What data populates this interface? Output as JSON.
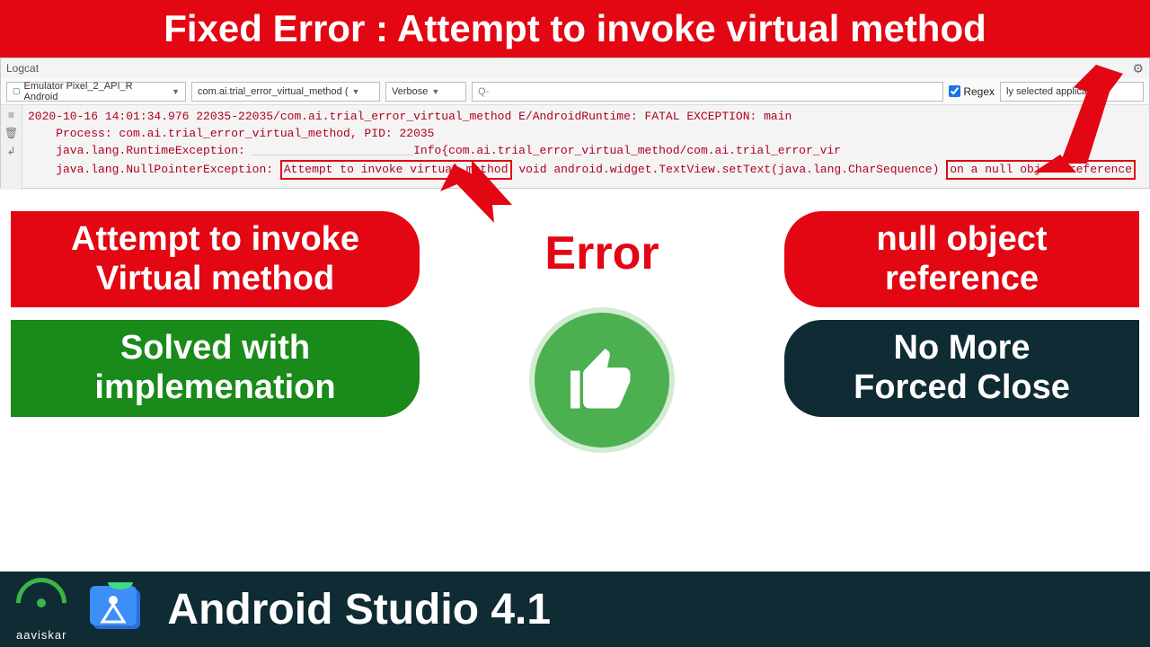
{
  "header": {
    "title": "Fixed Error : Attempt to invoke virtual method"
  },
  "logcat": {
    "title": "Logcat",
    "device_dropdown": "Emulator Pixel_2_API_R Android",
    "app_dropdown": "com.ai.trial_error_virtual_method (",
    "level_dropdown": "Verbose",
    "filter_dropdown": "ly selected application",
    "search_placeholder": "Q-",
    "regex": "Regex",
    "lines": {
      "l1": "2020-10-16 14:01:34.976 22035-22035/com.ai.trial_error_virtual_method E/AndroidRuntime: FATAL EXCEPTION: main",
      "l2": "    Process: com.ai.trial_error_virtual_method, PID: 22035",
      "l3a": "    java.lang.RuntimeException:",
      "l3b": "{com.ai.trial_error_virtual_method/com.ai.trial_error_vir",
      "l4a": "    java.lang.NullPointerException:",
      "hl1": "Attempt to invoke virtual method",
      "l4b": "void android.widget.TextView.setText(java.lang.CharSequence)",
      "hl2": "on a null object reference"
    }
  },
  "callouts": {
    "attempt": "Attempt to invoke\nVirtual method",
    "nullref": "null object\nreference",
    "error": "Error",
    "solved": "Solved with\nimplemenation",
    "nomore": "No More\nForced Close"
  },
  "footer": {
    "brand": "aaviskar",
    "title": "Android Studio 4.1"
  }
}
